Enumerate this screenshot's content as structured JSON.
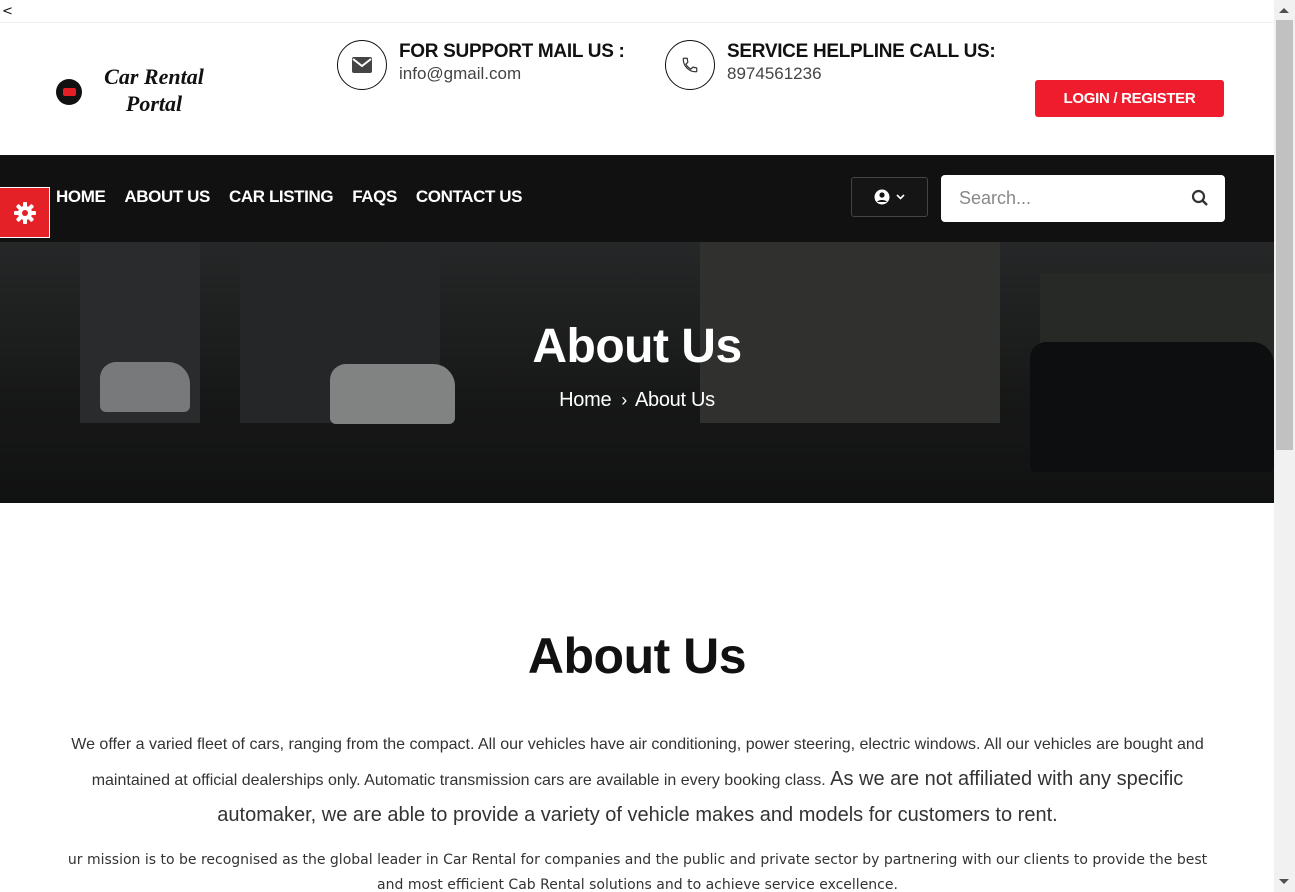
{
  "stray_char": "<",
  "brand": {
    "line1": "Car Rental",
    "line2": "Portal"
  },
  "support": {
    "title": "FOR SUPPORT MAIL US :",
    "value": "info@gmail.com",
    "icon": "envelope-icon"
  },
  "helpline": {
    "title": "SERVICE HELPLINE CALL US:",
    "value": "8974561236",
    "icon": "phone-icon"
  },
  "login_label": "LOGIN / REGISTER",
  "nav": {
    "items": [
      {
        "label": "HOME"
      },
      {
        "label": "ABOUT US"
      },
      {
        "label": "CAR LISTING"
      },
      {
        "label": "FAQS"
      },
      {
        "label": "CONTACT US"
      }
    ],
    "search_placeholder": "Search..."
  },
  "hero": {
    "title": "About Us",
    "breadcrumb": {
      "home": "Home",
      "separator": "›",
      "current": "About Us"
    }
  },
  "content": {
    "title": "About Us",
    "paragraph1_a": "We offer a varied fleet of cars, ranging from the compact. All our vehicles have air conditioning,  power steering, electric windows. All our vehicles are bought and maintained at official dealerships only. Automatic transmission cars are available in every booking class.",
    "paragraph1_b": "As we are not affiliated with any specific automaker, we are able to provide a variety of vehicle makes and models for customers to rent.",
    "paragraph2": "ur mission is to be recognised as the global leader in Car Rental for companies and the public and private sector by partnering with our clients to provide the best and most efficient Cab Rental solutions and to achieve service excellence."
  },
  "colors": {
    "accent": "#ef1c2d",
    "nav_bg": "#111111",
    "gear_bg": "#e32127"
  }
}
